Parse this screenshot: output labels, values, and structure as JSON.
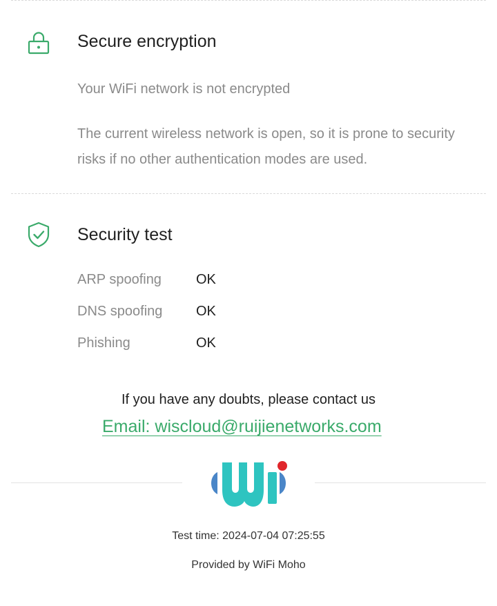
{
  "encryption": {
    "title": "Secure encryption",
    "icon": "lock-icon",
    "status": "Your WiFi network is not encrypted",
    "description": "The current wireless network is open, so it is prone to security risks if no other authentication modes are used."
  },
  "security_test": {
    "title": "Security test",
    "icon": "shield-check-icon",
    "items": [
      {
        "label": "ARP spoofing",
        "result": "OK"
      },
      {
        "label": "DNS spoofing",
        "result": "OK"
      },
      {
        "label": "Phishing",
        "result": "OK"
      }
    ]
  },
  "contact": {
    "text": "If you have any doubts, please contact us",
    "email": "Email: wiscloud@ruijienetworks.com"
  },
  "footer": {
    "logo": "wifi-moho-logo",
    "test_time": "Test time: 2024-07-04 07:25:55",
    "provided_by": "Provided by WiFi Moho"
  },
  "colors": {
    "accent_green": "#3aaa6a",
    "logo_teal": "#2ec4c0",
    "logo_blue": "#4a86c8",
    "logo_red": "#e0262b",
    "muted_text": "#8a8a8a",
    "primary_text": "#1f1f1f"
  }
}
